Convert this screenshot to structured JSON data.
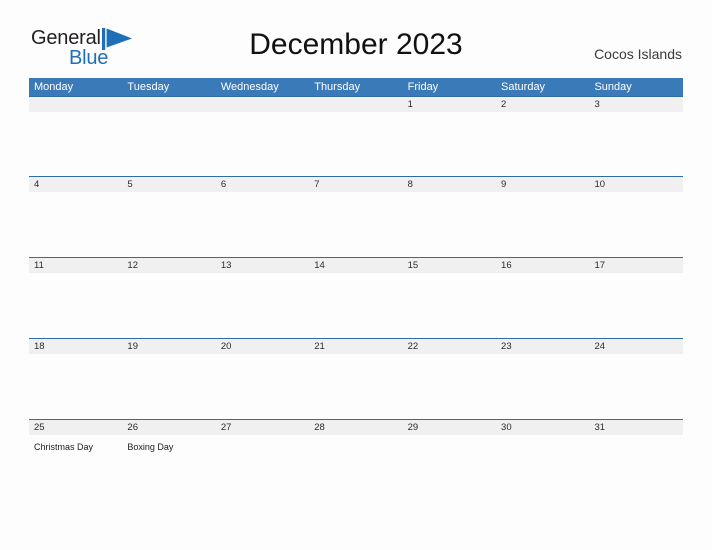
{
  "document": {
    "title": "December 2023",
    "location": "Cocos Islands",
    "logo": {
      "word_one": "General",
      "word_two": "Blue",
      "flag_icon": "triangle-flag-icon",
      "color_dark": "#231f20",
      "color_blue": "#1f6fb8"
    }
  },
  "theme": {
    "header_blue": "#3b7ab8",
    "divider_blue": "#2e6da8",
    "date_strip_gray": "#f0f0f0",
    "page_background": "#fdfdfd",
    "text_dark": "#2b2b2b"
  },
  "calendar": {
    "weekday_headers": [
      "Monday",
      "Tuesday",
      "Wednesday",
      "Thursday",
      "Friday",
      "Saturday",
      "Sunday"
    ],
    "weeks": [
      {
        "days": [
          {
            "date": "",
            "event": ""
          },
          {
            "date": "",
            "event": ""
          },
          {
            "date": "",
            "event": ""
          },
          {
            "date": "",
            "event": ""
          },
          {
            "date": "1",
            "event": ""
          },
          {
            "date": "2",
            "event": ""
          },
          {
            "date": "3",
            "event": ""
          }
        ]
      },
      {
        "days": [
          {
            "date": "4",
            "event": ""
          },
          {
            "date": "5",
            "event": ""
          },
          {
            "date": "6",
            "event": ""
          },
          {
            "date": "7",
            "event": ""
          },
          {
            "date": "8",
            "event": ""
          },
          {
            "date": "9",
            "event": ""
          },
          {
            "date": "10",
            "event": ""
          }
        ]
      },
      {
        "days": [
          {
            "date": "11",
            "event": ""
          },
          {
            "date": "12",
            "event": ""
          },
          {
            "date": "13",
            "event": ""
          },
          {
            "date": "14",
            "event": ""
          },
          {
            "date": "15",
            "event": ""
          },
          {
            "date": "16",
            "event": ""
          },
          {
            "date": "17",
            "event": ""
          }
        ]
      },
      {
        "days": [
          {
            "date": "18",
            "event": ""
          },
          {
            "date": "19",
            "event": ""
          },
          {
            "date": "20",
            "event": ""
          },
          {
            "date": "21",
            "event": ""
          },
          {
            "date": "22",
            "event": ""
          },
          {
            "date": "23",
            "event": ""
          },
          {
            "date": "24",
            "event": ""
          }
        ]
      },
      {
        "days": [
          {
            "date": "25",
            "event": "Christmas Day"
          },
          {
            "date": "26",
            "event": "Boxing Day"
          },
          {
            "date": "27",
            "event": ""
          },
          {
            "date": "28",
            "event": ""
          },
          {
            "date": "29",
            "event": ""
          },
          {
            "date": "30",
            "event": ""
          },
          {
            "date": "31",
            "event": ""
          }
        ]
      }
    ]
  }
}
